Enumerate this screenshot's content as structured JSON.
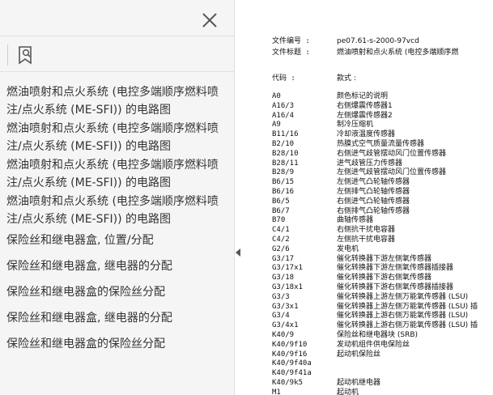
{
  "sidebar": {
    "close_icon": "close-icon",
    "bookmark_icon": "bookmark-search-icon",
    "collapse_icon": "triangle-left-icon",
    "bookmarks": [
      "燃油喷射和点火系统 (电控多端顺序燃料喷注/点火系统 (ME-SFI)) 的电路图",
      "燃油喷射和点火系统 (电控多端顺序燃料喷注/点火系统 (ME-SFI)) 的电路图",
      "燃油喷射和点火系统 (电控多端顺序燃料喷注/点火系统 (ME-SFI)) 的电路图",
      "燃油喷射和点火系统 (电控多端顺序燃料喷注/点火系统 (ME-SFI)) 的电路图",
      "保险丝和继电器盒, 位置/分配",
      "保险丝和继电器盒, 继电器的分配",
      "保险丝和继电器盒的保险丝分配",
      "保险丝和继电器盒, 继电器的分配",
      "保险丝和继电器盒的保险丝分配"
    ]
  },
  "doc": {
    "file_no_label": "文件编号 :",
    "file_no_value": "pe07.61-s-2000-97vcd",
    "file_title_label": "文件标题 :",
    "file_title_value": "燃油喷射和点火系统 (电控多端顺序燃",
    "code_header": "代码 :",
    "desc_header": "款式 :",
    "rows": [
      {
        "code": "A0",
        "desc": "颜色标记的说明"
      },
      {
        "code": "A16/3",
        "desc": "右侧爆震传感器1"
      },
      {
        "code": "A16/4",
        "desc": "左侧爆震传感器2"
      },
      {
        "code": "A9",
        "desc": "制冷压缩机"
      },
      {
        "code": "B11/16",
        "desc": "冷却液温度传感器"
      },
      {
        "code": "B2/10",
        "desc": "热膜式空气质量流量传感器"
      },
      {
        "code": "B28/10",
        "desc": "右侧进气歧管摆动风门位置传感器"
      },
      {
        "code": "B28/11",
        "desc": "进气歧管压力传感器"
      },
      {
        "code": "B28/9",
        "desc": "左侧进气歧管摆动风门位置传感器"
      },
      {
        "code": "B6/15",
        "desc": "左侧进气凸轮轴传感器"
      },
      {
        "code": "B6/16",
        "desc": "左侧排气凸轮轴传感器"
      },
      {
        "code": "B6/5",
        "desc": "右侧进气凸轮轴传感器"
      },
      {
        "code": "B6/7",
        "desc": "右侧排气凸轮轴传感器"
      },
      {
        "code": "B70",
        "desc": "曲轴传感器"
      },
      {
        "code": "C4/1",
        "desc": "右侧抗干扰电容器"
      },
      {
        "code": "C4/2",
        "desc": "左侧抗干扰电容器"
      },
      {
        "code": "G2/6",
        "desc": "发电机"
      },
      {
        "code": "G3/17",
        "desc": "催化转换器下游左侧氧传感器"
      },
      {
        "code": "G3/17x1",
        "desc": "催化转换器下游左侧氧传感器插接器"
      },
      {
        "code": "G3/18",
        "desc": "催化转换器下游右侧氧传感器"
      },
      {
        "code": "G3/18x1",
        "desc": "催化转换器下游右侧氧传感器插接器"
      },
      {
        "code": "G3/3",
        "desc": "催化转换器上游左侧万能氧传感器 (LSU)"
      },
      {
        "code": "G3/3x1",
        "desc": "催化转换器上游左侧万能氧传感器 (LSU) 插"
      },
      {
        "code": "G3/4",
        "desc": "催化转换器上游右侧万能氧传感器 (LSU)"
      },
      {
        "code": "G3/4x1",
        "desc": "催化转换器上游右侧万能氧传感器 (LSU) 插"
      },
      {
        "code": "K40/9",
        "desc": "保险丝和继电器块 (SRB)"
      },
      {
        "code": "K40/9f10",
        "desc": "发动机组件供电保险丝"
      },
      {
        "code": "K40/9f16",
        "desc": "起动机保险丝"
      },
      {
        "code": "K40/9f40a",
        "desc": ""
      },
      {
        "code": "K40/9f41a",
        "desc": ""
      },
      {
        "code": "K40/9k5",
        "desc": "起动机继电器"
      },
      {
        "code": "M1",
        "desc": "起动机"
      }
    ]
  },
  "colors": {
    "sidebar_bg": "#f5f5f5",
    "page_bg": "#ffffff",
    "text": "#333333",
    "muted_glyph": "#c8c8c8"
  }
}
